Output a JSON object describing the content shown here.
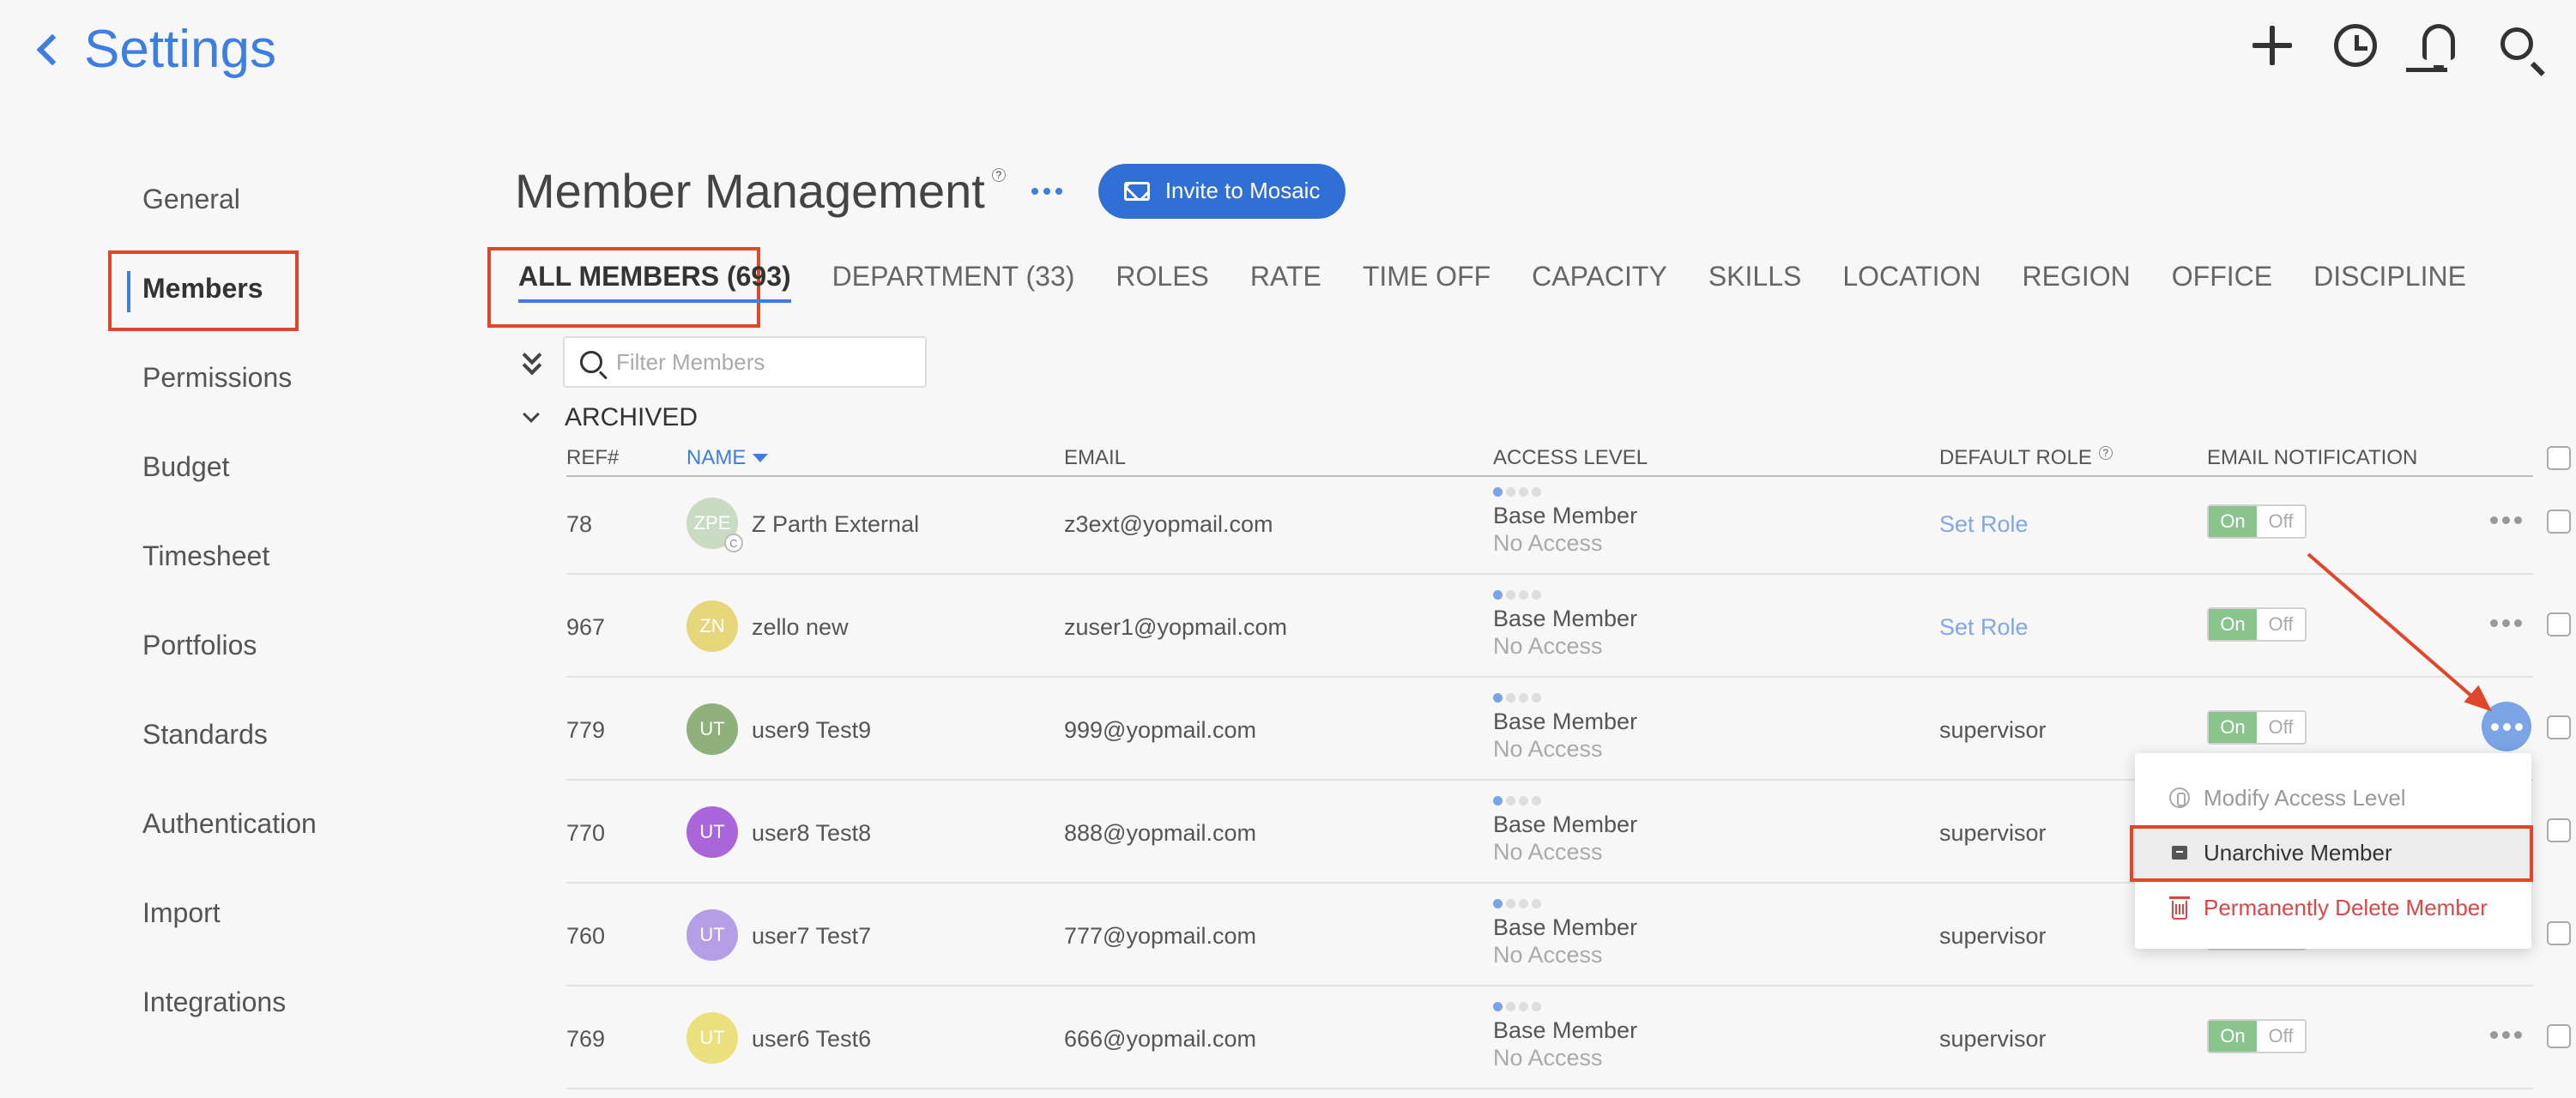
{
  "header": {
    "title": "Settings",
    "icons": [
      "plus-icon",
      "clock-icon",
      "bell-icon",
      "search-icon"
    ]
  },
  "sidebar": {
    "items": [
      {
        "label": "General",
        "active": false
      },
      {
        "label": "Members",
        "active": true
      },
      {
        "label": "Permissions",
        "active": false
      },
      {
        "label": "Budget",
        "active": false
      },
      {
        "label": "Timesheet",
        "active": false
      },
      {
        "label": "Portfolios",
        "active": false
      },
      {
        "label": "Standards",
        "active": false
      },
      {
        "label": "Authentication",
        "active": false
      },
      {
        "label": "Import",
        "active": false
      },
      {
        "label": "Integrations",
        "active": false
      }
    ]
  },
  "main": {
    "title": "Member Management",
    "help": "?",
    "invite_label": "Invite to Mosaic",
    "tabs": [
      "ALL MEMBERS (693)",
      "DEPARTMENT (33)",
      "ROLES",
      "RATE",
      "TIME OFF",
      "CAPACITY",
      "SKILLS",
      "LOCATION",
      "REGION",
      "OFFICE",
      "DISCIPLINE"
    ],
    "filter_placeholder": "Filter Members",
    "section": "ARCHIVED",
    "columns": {
      "ref": "REF#",
      "name": "NAME",
      "email": "EMAIL",
      "access": "ACCESS LEVEL",
      "role": "DEFAULT ROLE",
      "notify": "EMAIL NOTIFICATION"
    },
    "toggle_on": "On",
    "toggle_off": "Off",
    "rows": [
      {
        "ref": "78",
        "initials": "ZPE",
        "avatar_color": "#c9dcc3",
        "badge": "C",
        "name": "Z Parth External",
        "email": "z3ext@yopmail.com",
        "access1": "Base Member",
        "access2": "No Access",
        "role": "Set Role",
        "role_link": true
      },
      {
        "ref": "967",
        "initials": "ZN",
        "avatar_color": "#e6d67a",
        "badge": "",
        "name": "zello new",
        "email": "zuser1@yopmail.com",
        "access1": "Base Member",
        "access2": "No Access",
        "role": "Set Role",
        "role_link": true
      },
      {
        "ref": "779",
        "initials": "UT",
        "avatar_color": "#8fb07a",
        "badge": "",
        "name": "user9 Test9",
        "email": "999@yopmail.com",
        "access1": "Base Member",
        "access2": "No Access",
        "role": "supervisor",
        "role_link": false
      },
      {
        "ref": "770",
        "initials": "UT",
        "avatar_color": "#a965d9",
        "badge": "",
        "name": "user8 Test8",
        "email": "888@yopmail.com",
        "access1": "Base Member",
        "access2": "No Access",
        "role": "supervisor",
        "role_link": false
      },
      {
        "ref": "760",
        "initials": "UT",
        "avatar_color": "#b49ee6",
        "badge": "",
        "name": "user7 Test7",
        "email": "777@yopmail.com",
        "access1": "Base Member",
        "access2": "No Access",
        "role": "supervisor",
        "role_link": false
      },
      {
        "ref": "769",
        "initials": "UT",
        "avatar_color": "#ebe07e",
        "badge": "",
        "name": "user6 Test6",
        "email": "666@yopmail.com",
        "access1": "Base Member",
        "access2": "No Access",
        "role": "supervisor",
        "role_link": false
      }
    ],
    "menu": {
      "items": [
        "Modify Access Level",
        "Unarchive Member",
        "Permanently Delete Member"
      ]
    }
  },
  "colors": {
    "accent": "#3d7ee3",
    "highlight": "#e0472a",
    "danger": "#e04545"
  }
}
